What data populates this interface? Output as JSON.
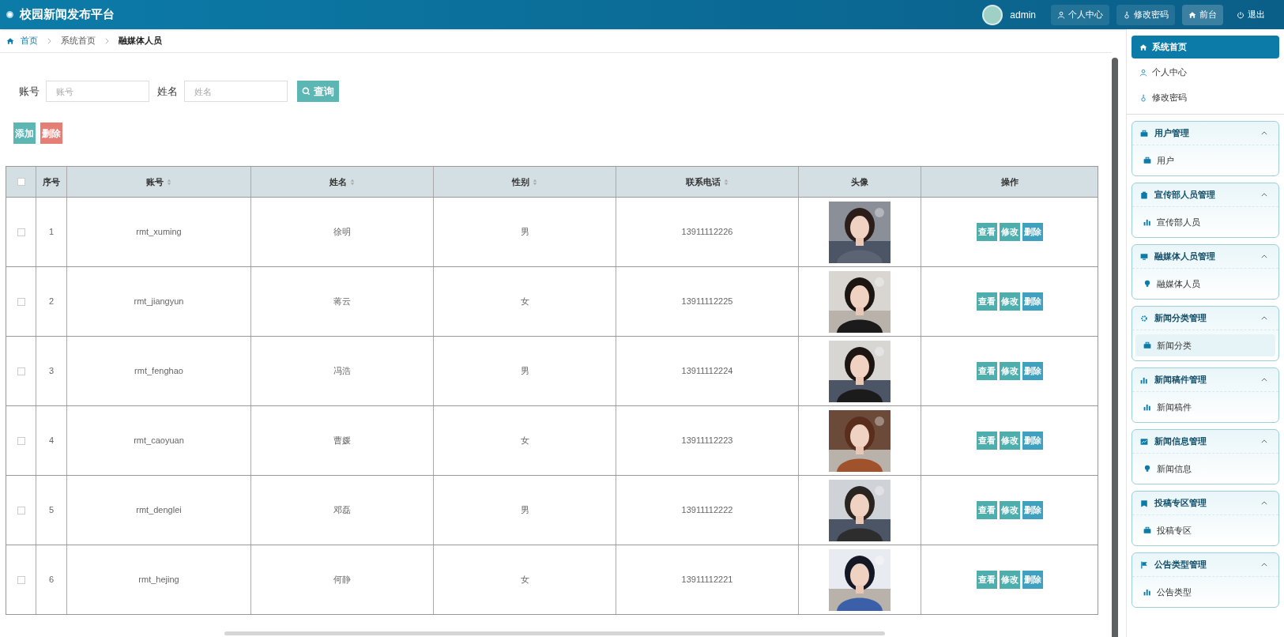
{
  "header": {
    "title": "校园新闻发布平台",
    "user": "admin",
    "links": [
      {
        "kind": "user",
        "label": "个人中心",
        "selected": false
      },
      {
        "kind": "key",
        "label": "修改密码",
        "selected": false
      },
      {
        "kind": "home",
        "label": "前台",
        "selected": true
      },
      {
        "kind": "power",
        "label": "退出",
        "selected": false
      }
    ]
  },
  "breadcrumb": [
    "首页",
    "系统首页",
    "融媒体人员"
  ],
  "search": {
    "fields": [
      {
        "label": "账号",
        "placeholder": "账号"
      },
      {
        "label": "姓名",
        "placeholder": "姓名"
      }
    ],
    "button": "查询"
  },
  "actions": [
    {
      "kind": "add",
      "label": "添加"
    },
    {
      "kind": "delete",
      "label": "删除"
    }
  ],
  "table": {
    "columns": [
      {
        "label": "序号",
        "sortable": false
      },
      {
        "label": "账号",
        "sortable": true
      },
      {
        "label": "姓名",
        "sortable": true
      },
      {
        "label": "性别",
        "sortable": true
      },
      {
        "label": "联系电话",
        "sortable": true
      },
      {
        "label": "头像",
        "sortable": false
      },
      {
        "label": "操作",
        "sortable": false
      }
    ],
    "all_checked": false,
    "rows": [
      {
        "no": "1",
        "account": "rmt_xuming",
        "name": "徐明",
        "gender": "男",
        "phone": "13911112226",
        "checked": false,
        "buttons": [
          "查看",
          "修改",
          "删除"
        ]
      },
      {
        "no": "2",
        "account": "rmt_jiangyun",
        "name": "蒋云",
        "gender": "女",
        "phone": "13911112225",
        "checked": false,
        "buttons": [
          "查看",
          "修改",
          "删除"
        ]
      },
      {
        "no": "3",
        "account": "rmt_fenghao",
        "name": "冯浩",
        "gender": "男",
        "phone": "13911112224",
        "checked": false,
        "buttons": [
          "查看",
          "修改",
          "删除"
        ]
      },
      {
        "no": "4",
        "account": "rmt_caoyuan",
        "name": "曹媛",
        "gender": "女",
        "phone": "13911112223",
        "checked": false,
        "buttons": [
          "查看",
          "修改",
          "删除"
        ]
      },
      {
        "no": "5",
        "account": "rmt_denglei",
        "name": "邓磊",
        "gender": "男",
        "phone": "13911112222",
        "checked": false,
        "buttons": [
          "查看",
          "修改",
          "删除"
        ]
      },
      {
        "no": "6",
        "account": "rmt_hejing",
        "name": "何静",
        "gender": "女",
        "phone": "13911112221",
        "checked": false,
        "buttons": [
          "查看",
          "修改",
          "删除"
        ]
      }
    ]
  },
  "sidebar": {
    "top": [
      {
        "kind": "home",
        "label": "系统首页",
        "selected": true
      },
      {
        "kind": "user",
        "label": "个人中心",
        "selected": false
      },
      {
        "kind": "key",
        "label": "修改密码",
        "selected": false
      }
    ],
    "groups": [
      {
        "kind": "bag",
        "label": "用户管理",
        "expanded": true,
        "items": [
          {
            "kind": "bag",
            "label": "用户",
            "highlighted": false
          }
        ]
      },
      {
        "kind": "clip",
        "label": "宣传部人员管理",
        "expanded": true,
        "items": [
          {
            "kind": "bars",
            "label": "宣传部人员",
            "highlighted": false
          }
        ]
      },
      {
        "kind": "monitor",
        "label": "融媒体人员管理",
        "expanded": true,
        "items": [
          {
            "kind": "bulb",
            "label": "融媒体人员",
            "highlighted": false
          }
        ]
      },
      {
        "kind": "gear",
        "label": "新闻分类管理",
        "expanded": true,
        "items": [
          {
            "kind": "bag",
            "label": "新闻分类",
            "highlighted": true
          }
        ]
      },
      {
        "kind": "bars",
        "label": "新闻稿件管理",
        "expanded": true,
        "items": [
          {
            "kind": "bars",
            "label": "新闻稿件",
            "highlighted": false
          }
        ]
      },
      {
        "kind": "chart",
        "label": "新闻信息管理",
        "expanded": true,
        "items": [
          {
            "kind": "bulb",
            "label": "新闻信息",
            "highlighted": false
          }
        ]
      },
      {
        "kind": "book",
        "label": "投稿专区管理",
        "expanded": true,
        "items": [
          {
            "kind": "bag",
            "label": "投稿专区",
            "highlighted": false
          }
        ]
      },
      {
        "kind": "flag",
        "label": "公告类型管理",
        "expanded": true,
        "items": [
          {
            "kind": "bars",
            "label": "公告类型",
            "highlighted": false
          }
        ]
      }
    ]
  }
}
